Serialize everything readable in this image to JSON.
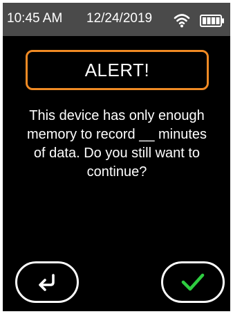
{
  "status_bar": {
    "time": "10:45 AM",
    "date": "12/24/2019",
    "wifi_icon": "wifi-icon",
    "battery_icon": "battery-full-icon"
  },
  "dialog": {
    "title": "ALERT!",
    "message": "This device has only enough memory to record __ minutes of data. Do you still want to continue?",
    "border_color": "#f08a24"
  },
  "buttons": {
    "back_icon": "return-arrow-icon",
    "confirm_icon": "checkmark-icon",
    "confirm_color": "#2ecc40"
  }
}
